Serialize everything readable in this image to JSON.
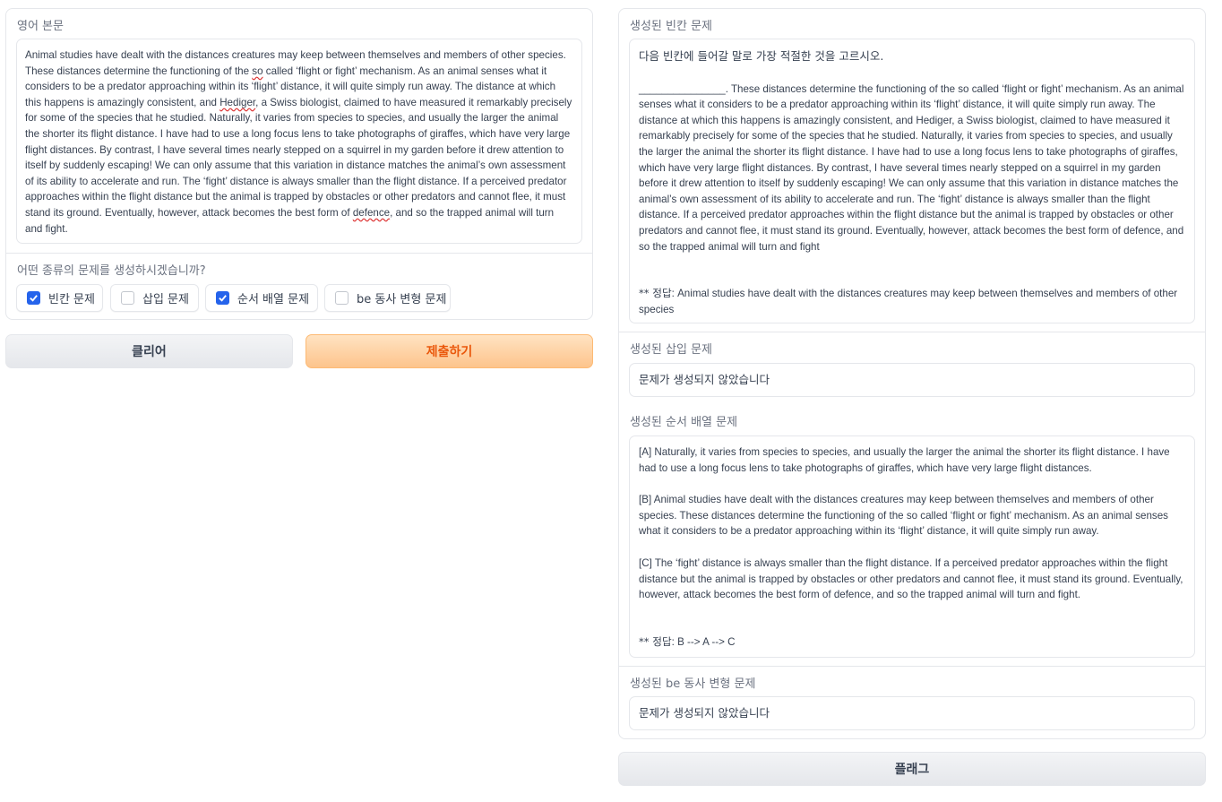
{
  "left": {
    "source_label": "영어 본문",
    "source_text_parts": [
      "Animal studies have dealt with the distances creatures may keep between themselves and members of other species. These distances determine the functioning of the ",
      "so",
      " called ‘flight or fight’ mechanism. As an animal senses what it considers to be a predator approaching within its ‘flight’ distance, it will quite simply run away. The distance at which this happens is amazingly consistent, and ",
      "Hediger",
      ", a Swiss biologist, claimed to have measured it remarkably precisely for some of the species that he studied. Naturally, it varies from species to species, and usually the larger the animal the shorter its flight distance. I have had to use a long focus lens to take photographs of giraffes, which have very large flight distances. By contrast, I have several times nearly stepped on a squirrel in my garden before it drew attention to itself by suddenly escaping! We can only assume that this variation in distance matches the animal’s own assessment of its ability to accelerate and run. The ‘fight’ distance is always smaller than the flight distance. If a perceived predator approaches within the flight distance but the animal is trapped by obstacles or other predators and cannot flee, it must stand its ground. Eventually, however, attack becomes the best form of ",
      "defence",
      ", and so the trapped animal will turn and fight."
    ],
    "question_type_label": "어떤 종류의 문제를 생성하시겠습니까?",
    "options": [
      {
        "label": "빈칸 문제",
        "checked": true
      },
      {
        "label": "삽입 문제",
        "checked": false
      },
      {
        "label": "순서 배열 문제",
        "checked": true
      },
      {
        "label": "be 동사 변형 문제",
        "checked": false
      }
    ],
    "clear_label": "클리어",
    "submit_label": "제출하기"
  },
  "right": {
    "blank": {
      "label": "생성된 빈칸 문제",
      "instruction": "다음 빈칸에 들어갈 말로 가장 적절한 것을 고르시오.",
      "body": "_______________.  These distances determine the functioning of the so called ‘flight or fight’ mechanism.  As an animal senses what it considers to be a predator approaching within its ‘flight’ distance, it will quite simply run away.  The distance at which this happens is amazingly consistent, and Hediger, a Swiss biologist, claimed to have measured it remarkably precisely for some of the species that he studied.  Naturally, it varies from species to species, and usually the larger the animal the shorter its flight distance.  I have had to use a long focus lens to take photographs of giraffes, which have very large flight distances.  By contrast, I have several times nearly stepped on a squirrel in my garden before it drew attention to itself by suddenly escaping! We can only assume that this variation in distance matches the animal’s own assessment of its ability to accelerate and run.  The ‘fight’ distance is always smaller than the flight distance.  If a perceived predator approaches within the flight distance but the animal is trapped by obstacles or other predators and cannot flee, it must stand its ground.  Eventually, however, attack becomes the best form of defence, and so the trapped animal will turn and fight",
      "answer_prefix": "** 정답",
      "answer": ": Animal studies have dealt with the distances creatures may keep between themselves and members of other species"
    },
    "insertion": {
      "label": "생성된 삽입 문제",
      "value": "문제가 생성되지 않았습니다"
    },
    "ordering": {
      "label": "생성된 순서 배열 문제",
      "paragraphs": [
        "[A]  Naturally, it varies from species to species, and usually the larger the animal the shorter its flight distance. I have had to use a long focus lens to take photographs of giraffes, which have very large flight distances.",
        "[B] Animal studies have dealt with the distances creatures may keep between themselves and members of other species. These distances determine the functioning of the so called ‘flight or fight’ mechanism. As an animal senses what it considers to be a predator approaching within its ‘flight’ distance, it will quite simply run away.",
        "[C]  The ‘fight’ distance is always smaller than the flight distance. If a perceived predator approaches within the flight distance but the animal is trapped by obstacles or other predators and cannot flee, it must stand its ground. Eventually, however, attack becomes the best form of defence, and so the trapped animal will turn and fight."
      ],
      "answer_prefix": "** 정답",
      "answer": ": B --> A --> C"
    },
    "be_verb": {
      "label": "생성된 be 동사 변형 문제",
      "value": "문제가 생성되지 않았습니다"
    },
    "flag_label": "플래그"
  },
  "colors": {
    "accent": "#2563eb",
    "primary_button_text": "#ea580c",
    "border": "#e5e7eb"
  }
}
